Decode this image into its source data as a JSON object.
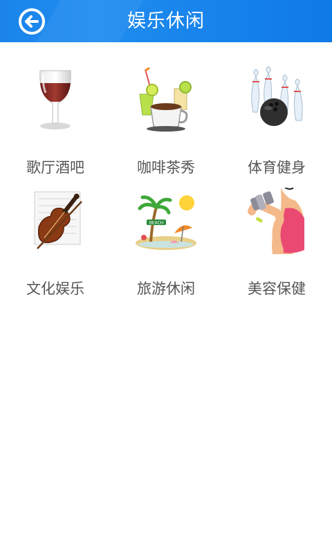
{
  "header": {
    "title": "娱乐休闲",
    "back_icon": "back-arrow-icon",
    "bg_color": "#1a84ea"
  },
  "categories": [
    {
      "label": "歌厅酒吧",
      "icon": "wine-glass-icon"
    },
    {
      "label": "咖啡茶秀",
      "icon": "coffee-drinks-icon"
    },
    {
      "label": "体育健身",
      "icon": "bowling-icon"
    },
    {
      "label": "文化娱乐",
      "icon": "violin-icon"
    },
    {
      "label": "旅游休闲",
      "icon": "beach-icon"
    },
    {
      "label": "美容保健",
      "icon": "fitness-woman-icon"
    }
  ]
}
